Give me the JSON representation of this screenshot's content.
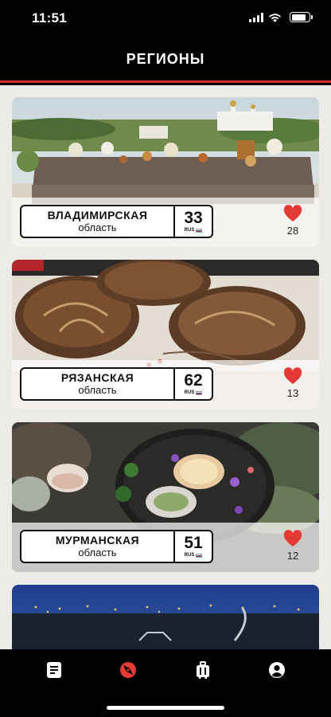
{
  "status": {
    "time": "11:51"
  },
  "header": {
    "title": "РЕГИОНЫ"
  },
  "regions": [
    {
      "name": "ВЛАДИМИРСКАЯ",
      "subtitle": "область",
      "code": "33",
      "country": "RUS",
      "likes": "28"
    },
    {
      "name": "РЯЗАНСКАЯ",
      "subtitle": "область",
      "code": "62",
      "country": "RUS",
      "likes": "13"
    },
    {
      "name": "МУРМАНСКАЯ",
      "subtitle": "область",
      "code": "51",
      "country": "RUS",
      "likes": "12"
    }
  ],
  "tabbar": {
    "items": [
      {
        "icon": "news-icon",
        "active": false
      },
      {
        "icon": "compass-icon",
        "active": true
      },
      {
        "icon": "suitcase-icon",
        "active": false
      },
      {
        "icon": "profile-icon",
        "active": false
      }
    ]
  },
  "colors": {
    "accent": "#d32f2f",
    "like": "#e53935",
    "background": "#edebe7",
    "bars": "#000000"
  }
}
